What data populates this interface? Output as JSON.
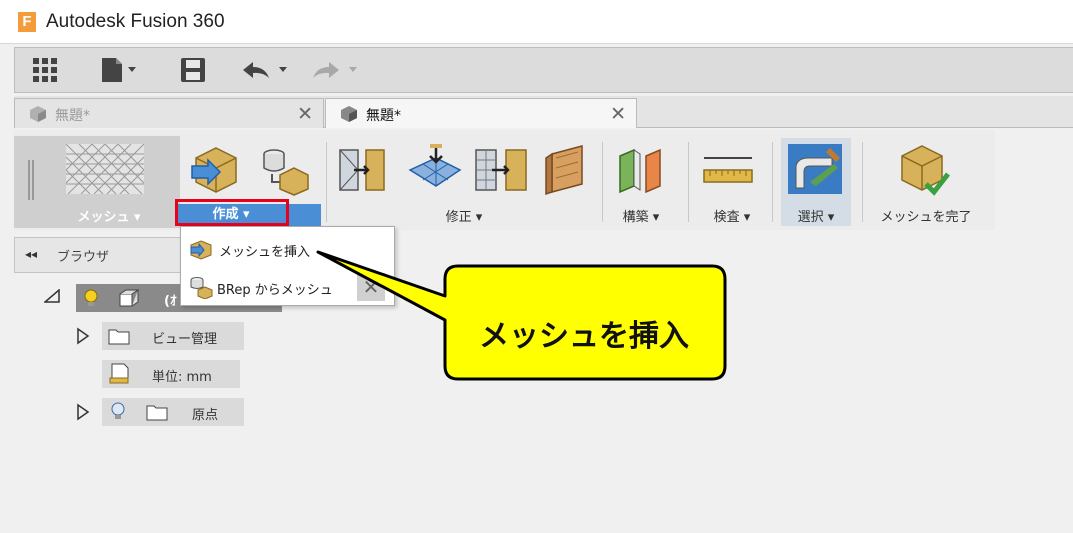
{
  "window": {
    "title": "Autodesk Fusion 360",
    "logo_letter": "F"
  },
  "tabs": [
    {
      "label": "無題*",
      "close": "✕",
      "active": false
    },
    {
      "label": "無題*",
      "close": "✕",
      "active": true
    }
  ],
  "ribbon": {
    "workspace_label": "メッシュ ▾",
    "groups": {
      "create": "作成 ▾",
      "modify": "修正 ▾",
      "construct": "構築 ▾",
      "inspect": "検査 ▾",
      "select": "選択 ▾",
      "finish": "メッシュを完了"
    }
  },
  "dropdown": {
    "items": [
      {
        "label": "メッシュを挿入"
      },
      {
        "label": "BRep からメッシュ"
      }
    ],
    "close": "✕"
  },
  "browser": {
    "title": "ブラウザ",
    "collapse_arrows": "◂◂",
    "root_partial": "(ｵ",
    "nodes": [
      {
        "label": "ビュー管理"
      },
      {
        "label": "単位: mm"
      },
      {
        "label": "原点"
      }
    ]
  },
  "callout": {
    "text": "メッシュを挿入"
  },
  "colors": {
    "highlight": "#e8001c",
    "create_bar": "#4a8fd6",
    "callout_fill": "#ffff00"
  }
}
